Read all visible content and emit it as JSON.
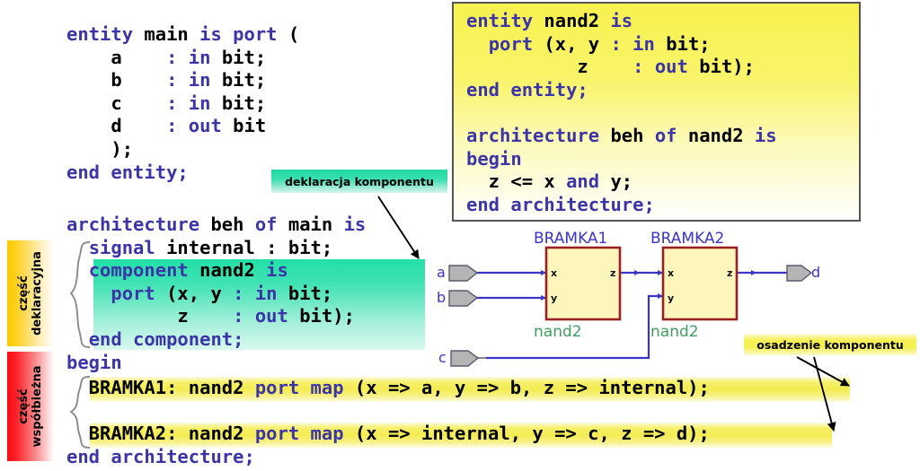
{
  "main_code": {
    "lines": [
      [
        {
          "t": "entity ",
          "c": "kw"
        },
        {
          "t": "main ",
          "c": "id"
        },
        {
          "t": "is port ",
          "c": "kw"
        },
        {
          "t": "(",
          "c": "id"
        }
      ],
      [
        {
          "t": "    a    ",
          "c": "id"
        },
        {
          "t": ": in ",
          "c": "kw"
        },
        {
          "t": "bit;",
          "c": "id"
        }
      ],
      [
        {
          "t": "    b    ",
          "c": "id"
        },
        {
          "t": ": in ",
          "c": "kw"
        },
        {
          "t": "bit;",
          "c": "id"
        }
      ],
      [
        {
          "t": "    c    ",
          "c": "id"
        },
        {
          "t": ": in ",
          "c": "kw"
        },
        {
          "t": "bit;",
          "c": "id"
        }
      ],
      [
        {
          "t": "    d    ",
          "c": "id"
        },
        {
          "t": ": out ",
          "c": "kw"
        },
        {
          "t": "bit",
          "c": "id"
        }
      ],
      [
        {
          "t": "    );",
          "c": "id"
        }
      ],
      [
        {
          "t": "end entity;",
          "c": "kw"
        }
      ]
    ]
  },
  "arch_code": {
    "lines": [
      [
        {
          "t": "architecture ",
          "c": "kw"
        },
        {
          "t": "beh ",
          "c": "id"
        },
        {
          "t": "of ",
          "c": "kw"
        },
        {
          "t": "main ",
          "c": "id"
        },
        {
          "t": "is",
          "c": "kw"
        }
      ],
      [
        {
          "t": "  ",
          "c": "id"
        },
        {
          "t": "signal ",
          "c": "kw"
        },
        {
          "t": "internal : ",
          "c": "id"
        },
        {
          "t": "bit;",
          "c": "id"
        }
      ],
      [
        {
          "t": "  ",
          "c": "id"
        },
        {
          "t": "component ",
          "c": "kw"
        },
        {
          "t": "nand2 ",
          "c": "id"
        },
        {
          "t": "is",
          "c": "kw"
        }
      ],
      [
        {
          "t": "    ",
          "c": "id"
        },
        {
          "t": "port ",
          "c": "kw"
        },
        {
          "t": "(x, y ",
          "c": "id"
        },
        {
          "t": ": in ",
          "c": "kw"
        },
        {
          "t": "bit;",
          "c": "id"
        }
      ],
      [
        {
          "t": "          z    ",
          "c": "id"
        },
        {
          "t": ": out ",
          "c": "kw"
        },
        {
          "t": "bit);",
          "c": "id"
        }
      ],
      [
        {
          "t": "  ",
          "c": "id"
        },
        {
          "t": "end component;",
          "c": "kw"
        }
      ],
      [
        {
          "t": "begin",
          "c": "kw"
        }
      ]
    ]
  },
  "portmap_code": {
    "lines": [
      [
        {
          "t": "  BRAMKA1: nand2 ",
          "c": "id"
        },
        {
          "t": "port map ",
          "c": "kw"
        },
        {
          "t": "(x => a, y => b, z => internal);",
          "c": "id"
        }
      ],
      [
        {
          "t": "",
          "c": "id"
        }
      ],
      [
        {
          "t": "  BRAMKA2: nand2 ",
          "c": "id"
        },
        {
          "t": "port map ",
          "c": "kw"
        },
        {
          "t": "(x => internal, y => c, z => d);",
          "c": "id"
        }
      ],
      [
        {
          "t": "end architecture;",
          "c": "kw"
        }
      ]
    ]
  },
  "nand_code": {
    "lines": [
      [
        {
          "t": "entity ",
          "c": "kw"
        },
        {
          "t": "nand2 ",
          "c": "id"
        },
        {
          "t": "is",
          "c": "kw"
        }
      ],
      [
        {
          "t": "  ",
          "c": "id"
        },
        {
          "t": "port ",
          "c": "kw"
        },
        {
          "t": "(x, y ",
          "c": "id"
        },
        {
          "t": ": in ",
          "c": "kw"
        },
        {
          "t": "bit;",
          "c": "id"
        }
      ],
      [
        {
          "t": "          z    ",
          "c": "id"
        },
        {
          "t": ": out ",
          "c": "kw"
        },
        {
          "t": "bit);",
          "c": "id"
        }
      ],
      [
        {
          "t": "end entity;",
          "c": "kw"
        }
      ],
      [
        {
          "t": "",
          "c": "id"
        }
      ],
      [
        {
          "t": "architecture ",
          "c": "kw"
        },
        {
          "t": "beh ",
          "c": "id"
        },
        {
          "t": "of ",
          "c": "kw"
        },
        {
          "t": "nand2 ",
          "c": "id"
        },
        {
          "t": "is",
          "c": "kw"
        }
      ],
      [
        {
          "t": "begin",
          "c": "kw"
        }
      ],
      [
        {
          "t": "  z <= x ",
          "c": "id"
        },
        {
          "t": "and ",
          "c": "kw"
        },
        {
          "t": "y;",
          "c": "id"
        }
      ],
      [
        {
          "t": "end architecture;",
          "c": "kw"
        }
      ]
    ]
  },
  "section_labels": {
    "declarative": "część\ndeklaracyjna",
    "declarative_line1": "część",
    "declarative_line2": "deklaracyjna",
    "concurrent_line1": "część",
    "concurrent_line2": "współbieżna"
  },
  "callouts": {
    "declaration": "deklaracja komponentu",
    "instantiation": "osadzenie komponentu"
  },
  "circuit": {
    "gate1_name": "BRAMKA1",
    "gate2_name": "BRAMKA2",
    "gate1_type": "nand2",
    "gate2_type": "nand2",
    "inputs": [
      "a",
      "b",
      "c"
    ],
    "outputs": [
      "d"
    ],
    "gate1_pins": {
      "in1": "x",
      "in2": "y",
      "out": "z"
    },
    "gate2_pins": {
      "in1": "x",
      "in2": "y",
      "out": "z"
    },
    "colors": {
      "gate_fill": "#fcf6bd",
      "gate_border": "#9b2020",
      "wire": "#3b35c8",
      "port_fill": "#b5b5b5",
      "label_blue": "#3b35c8",
      "label_green": "#3f9e5e"
    }
  },
  "palette": {
    "keyword": "#3b35a8",
    "identifier": "#000000",
    "highlight_green": "#22dfa6",
    "highlight_yellow": "#f4ec52",
    "declarative_band": "#ffc800",
    "concurrent_band": "#fa0a14"
  }
}
